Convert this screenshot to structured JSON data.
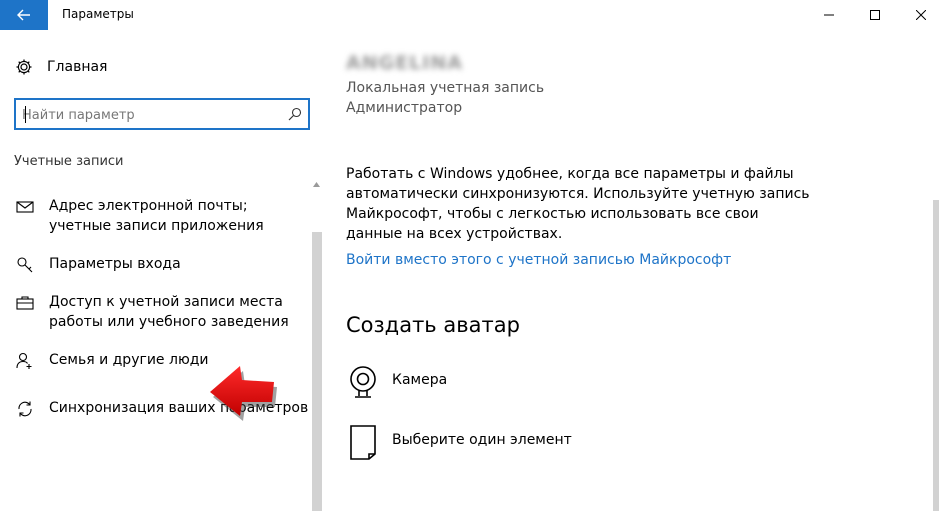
{
  "window": {
    "title": "Параметры",
    "controls": {
      "minimize": "minimize-icon",
      "maximize": "maximize-icon",
      "close": "close-icon"
    }
  },
  "sidebar": {
    "home_label": "Главная",
    "search_placeholder": "Найти параметр",
    "section_label": "Учетные записи",
    "items": [
      {
        "label": "Адрес электронной почты; учетные записи приложения",
        "icon": "mail-icon"
      },
      {
        "label": "Параметры входа",
        "icon": "key-icon"
      },
      {
        "label": "Доступ к учетной записи места работы или учебного заведения",
        "icon": "briefcase-icon"
      },
      {
        "label": "Семья и другие люди",
        "icon": "person-add-icon"
      },
      {
        "label": "Синхронизация ваших параметров",
        "icon": "sync-icon"
      }
    ]
  },
  "account": {
    "username": "ANGELINA",
    "type": "Локальная учетная запись",
    "role": "Администратор",
    "description": "Работать с Windows удобнее, когда все параметры и файлы автоматически синхронизуются. Используйте учетную запись Майкрософт, чтобы с легкостью использовать все свои данные на всех устройствах.",
    "link": "Войти вместо этого с учетной записью Майкрософт"
  },
  "avatar": {
    "heading": "Создать аватар",
    "options": [
      {
        "label": "Камера",
        "icon": "camera-icon"
      },
      {
        "label": "Выберите один элемент",
        "icon": "browse-icon"
      }
    ]
  },
  "colors": {
    "accent": "#1e74c8",
    "arrow": "#e00000"
  }
}
